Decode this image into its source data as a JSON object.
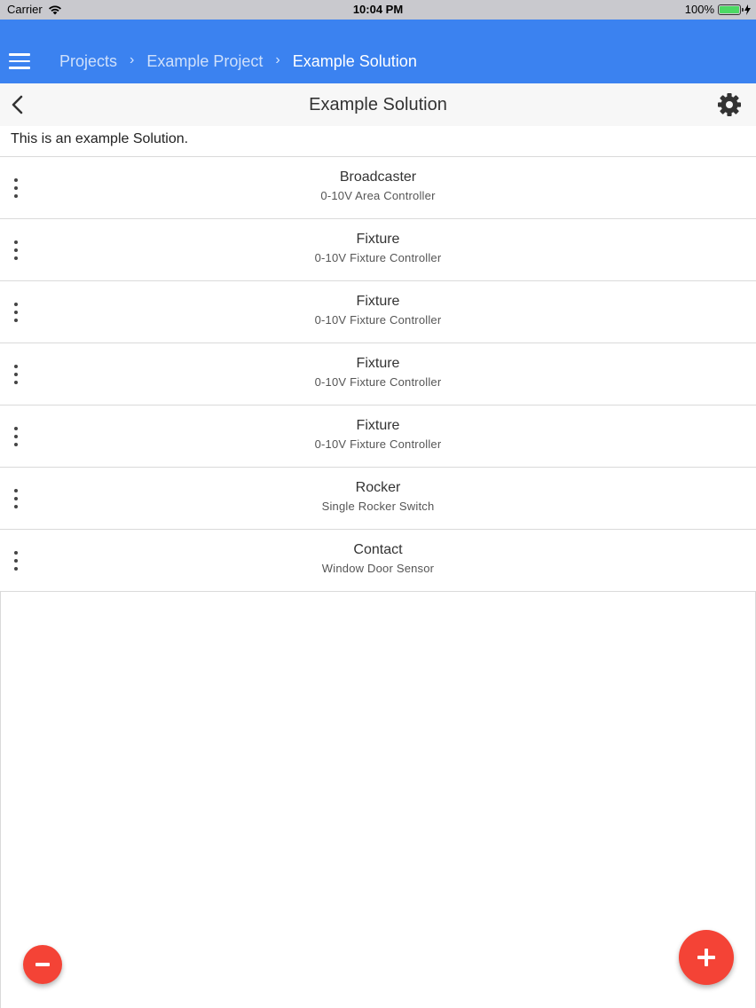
{
  "status_bar": {
    "carrier": "Carrier",
    "time": "10:04 PM",
    "battery": "100%",
    "battery_level": 1.0
  },
  "app_bar": {
    "breadcrumb": [
      "Projects",
      "Example Project",
      "Example Solution"
    ],
    "color": "#3b82f0"
  },
  "header": {
    "title": "Example Solution"
  },
  "description": "This is an example Solution.",
  "devices": [
    {
      "name": "Broadcaster",
      "type": "0-10V Area Controller"
    },
    {
      "name": "Fixture",
      "type": "0-10V Fixture Controller"
    },
    {
      "name": "Fixture",
      "type": "0-10V Fixture Controller"
    },
    {
      "name": "Fixture",
      "type": "0-10V Fixture Controller"
    },
    {
      "name": "Fixture",
      "type": "0-10V Fixture Controller"
    },
    {
      "name": "Rocker",
      "type": "Single Rocker Switch"
    },
    {
      "name": "Contact",
      "type": "Window Door Sensor"
    }
  ],
  "fab_color": "#f44336"
}
